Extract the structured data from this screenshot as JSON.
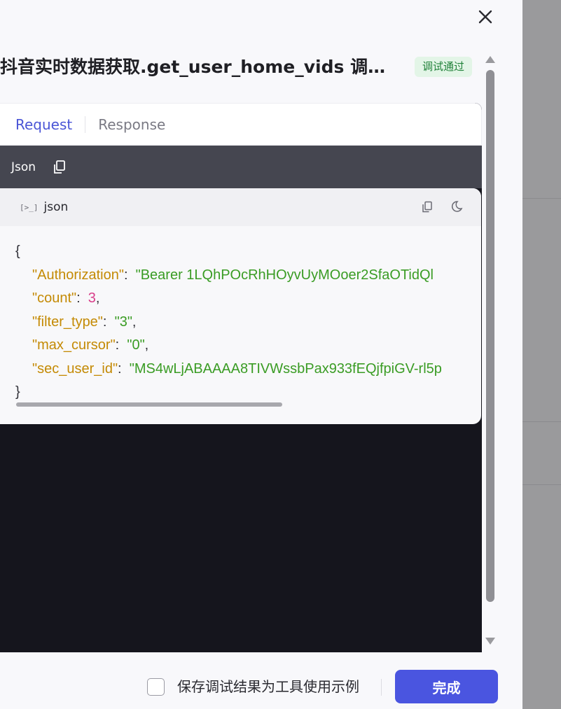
{
  "drawer": {
    "title": "抖音实时数据获取.get_user_home_vids 调试详情",
    "status_badge": "调试通过"
  },
  "tabs": [
    {
      "label": "Request",
      "active": true
    },
    {
      "label": "Response",
      "active": false
    }
  ],
  "json_bar": {
    "label": "Json"
  },
  "code_card": {
    "language": "json",
    "lines": {
      "open": "{",
      "close": "}",
      "authorization_key": "\"Authorization\"",
      "authorization_value": "\"Bearer 1LQhPOcRhHOyvUyMOoer2SfaOTidQl",
      "count_key": "\"count\"",
      "count_value": "3",
      "filter_type_key": "\"filter_type\"",
      "filter_type_value": "\"3\"",
      "max_cursor_key": "\"max_cursor\"",
      "max_cursor_value": "\"0\"",
      "sec_user_id_key": "\"sec_user_id\"",
      "sec_user_id_value": "\"MS4wLjABAAAA8TIVWssbPax933fEQjfpiGV-rl5p"
    }
  },
  "footer": {
    "checkbox_label": "保存调试结果为工具使用示例",
    "checkbox_checked": false,
    "done_label": "完成"
  },
  "colors": {
    "accent": "#4a55e0",
    "status_green": "#21823a",
    "json_key": "#c48a04",
    "json_string": "#3a9c24",
    "json_number": "#d93e8a"
  },
  "icons": {
    "close": "close-icon",
    "copy": "copy-icon",
    "terminal": "terminal-icon",
    "theme": "moon-icon"
  }
}
